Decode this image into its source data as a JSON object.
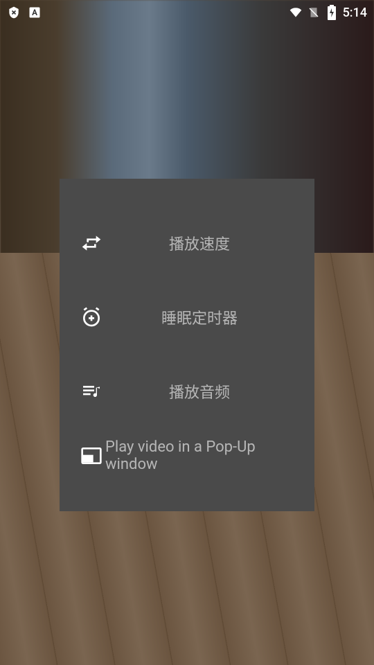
{
  "status_bar": {
    "time": "5:14"
  },
  "menu": {
    "items": [
      {
        "label": "播放速度"
      },
      {
        "label": "睡眠定时器"
      },
      {
        "label": "播放音频"
      },
      {
        "label": "Play video in a Pop-Up window"
      }
    ]
  }
}
